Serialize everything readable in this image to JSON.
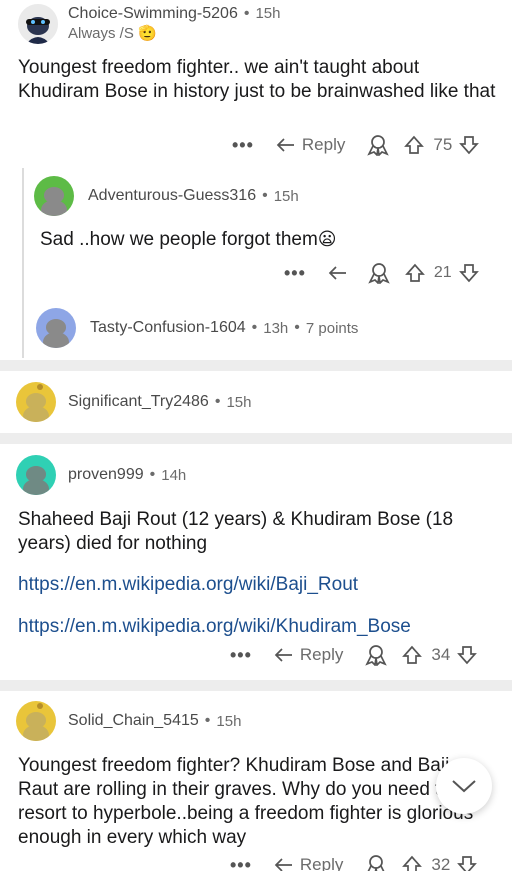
{
  "comments": [
    {
      "username": "Choice-Swimming-5206",
      "time": "15h",
      "flair": "Always /S",
      "text": "Youngest freedom fighter.. we ain't taught about Khudiram Bose in history just to be brainwashed like that",
      "reply_label": "Reply",
      "votes": "75"
    },
    {
      "username": "Adventurous-Guess316",
      "time": "15h",
      "text": "Sad ..how we people forgot them",
      "votes": "21"
    },
    {
      "username": "Tasty-Confusion-1604",
      "time": "13h",
      "points": "7 points"
    },
    {
      "username": "Significant_Try2486",
      "time": "15h"
    },
    {
      "username": "proven999",
      "time": "14h",
      "text": "Shaheed Baji Rout (12 years) & Khudiram Bose (18 years) died for nothing",
      "link1": "https://en.m.wikipedia.org/wiki/Baji_Rout",
      "link2": "https://en.m.wikipedia.org/wiki/Khudiram_Bose",
      "reply_label": "Reply",
      "votes": "34"
    },
    {
      "username": "Solid_Chain_5415",
      "time": "15h",
      "text": "Youngest freedom fighter? Khudiram Bose and Baji Raut are rolling in their graves. Why do you need to resort to hyperbole..being a freedom fighter is glorious enough in every which way",
      "reply_label": "Reply",
      "votes": "32"
    }
  ],
  "glyphs": {
    "more": "•••",
    "dot": "•",
    "emoji_flair": "🫡",
    "emoji_sad": "😦",
    "chevron": "﹀"
  },
  "colors": {
    "avatar_yellow": "#e9c53a",
    "avatar_green": "#5dbb46",
    "avatar_blue": "#8ea6e6",
    "avatar_teal": "#2fd0b4",
    "link": "#1d4f8e"
  }
}
